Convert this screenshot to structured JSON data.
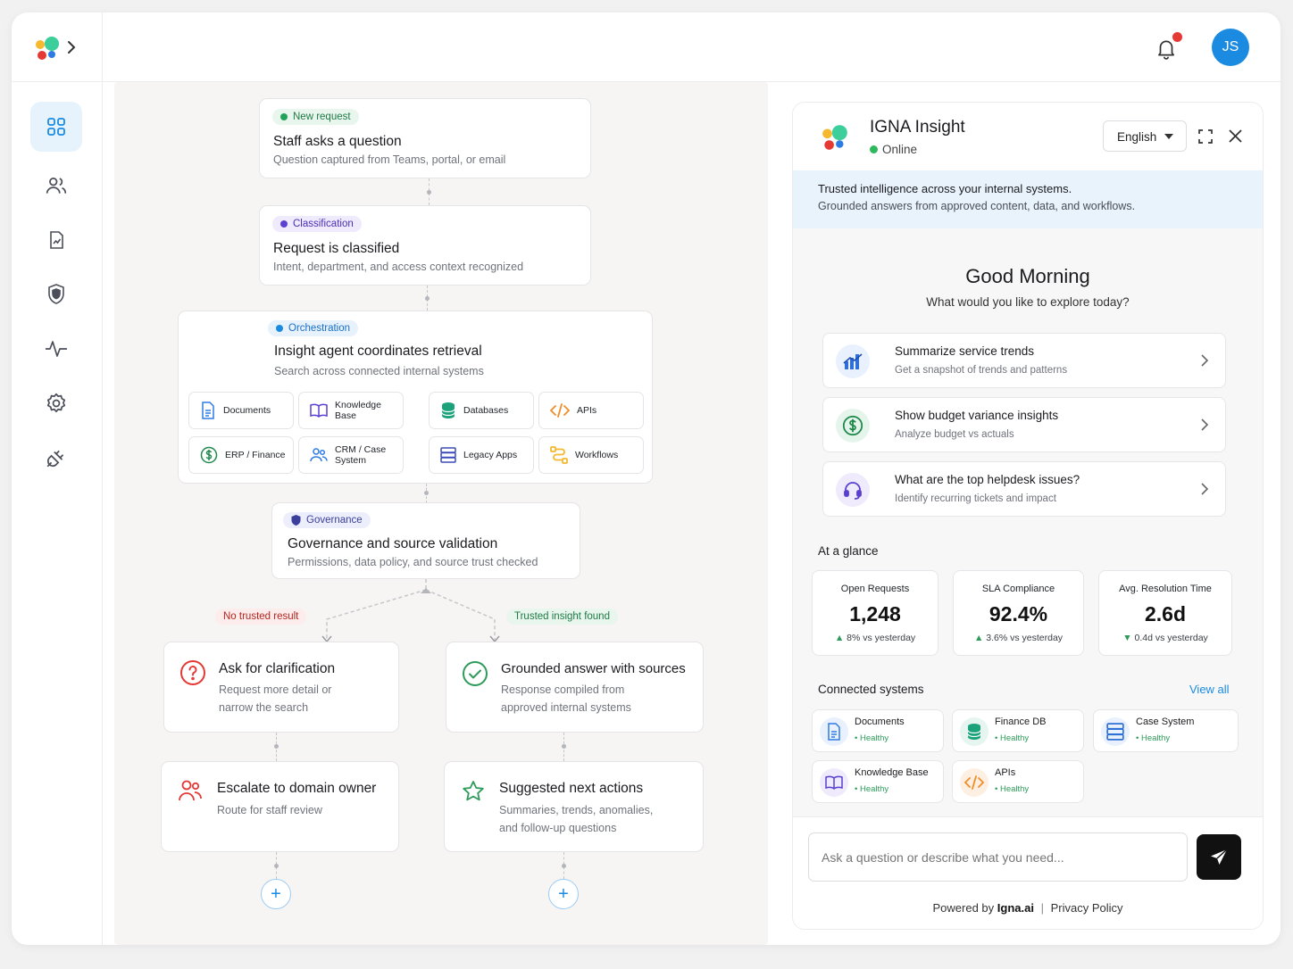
{
  "topbar": {
    "avatar_initials": "JS",
    "notification_dot": true
  },
  "sidebar": {
    "items": [
      {
        "name": "dashboard",
        "icon": "grid-icon",
        "active": true
      },
      {
        "name": "users",
        "icon": "users-icon"
      },
      {
        "name": "reports",
        "icon": "report-icon"
      },
      {
        "name": "security",
        "icon": "shield-icon"
      },
      {
        "name": "activity",
        "icon": "activity-icon"
      },
      {
        "name": "settings",
        "icon": "gear-icon"
      },
      {
        "name": "integrations",
        "icon": "plug-icon"
      }
    ]
  },
  "flow": {
    "step1": {
      "badge": "New request",
      "title": "Staff asks a question",
      "subtitle": "Question captured from Teams, portal, or email"
    },
    "step2": {
      "badge": "Classification",
      "title": "Request is classified",
      "subtitle": "Intent, department, and access context recognized"
    },
    "step3": {
      "badge": "Orchestration",
      "title": "Insight agent coordinates retrieval",
      "subtitle": "Search across connected internal systems",
      "sources": [
        "Documents",
        "Knowledge Base",
        "Databases",
        "APIs",
        "ERP / Finance",
        "CRM / Case System",
        "Legacy Apps",
        "Workflows"
      ]
    },
    "step4": {
      "badge": "Governance",
      "title": "Governance and source validation",
      "subtitle": "Permissions, data policy, and source trust checked"
    },
    "branch_fail_label": "No trusted result",
    "branch_ok_label": "Trusted insight found",
    "clarify": {
      "title": "Ask for clarification",
      "line1": "Request more detail or",
      "line2": "narrow the search"
    },
    "escalate": {
      "title": "Escalate to domain owner",
      "subtitle": "Route for staff review"
    },
    "grounded": {
      "title": "Grounded answer with sources",
      "line1": "Response compiled from",
      "line2": "approved internal systems"
    },
    "actions": {
      "title": "Suggested next actions",
      "line1": "Summaries, trends, anomalies,",
      "line2": "and follow-up questions"
    },
    "add_symbol": "+"
  },
  "panel": {
    "title": "IGNA Insight",
    "status": "Online",
    "language": "English",
    "banner_title": "Trusted intelligence across your internal systems.",
    "banner_sub": "Grounded answers from approved content, data, and workflows.",
    "greeting": "Good Morning",
    "prompt": "What would you like to explore today?",
    "suggestions": [
      {
        "title": "Summarize service trends",
        "sub": "Get a snapshot of trends and patterns",
        "icon": "bar-chart-icon"
      },
      {
        "title": "Show budget variance insights",
        "sub": "Analyze budget vs actuals",
        "icon": "dollar-icon"
      },
      {
        "title": "What are the top helpdesk issues?",
        "sub": "Identify recurring tickets and impact",
        "icon": "headset-icon"
      }
    ],
    "glance_title": "At a glance",
    "stats": [
      {
        "label": "Open Requests",
        "value": "1,248",
        "delta": "8% vs yesterday",
        "dir": "up"
      },
      {
        "label": "SLA Compliance",
        "value": "92.4%",
        "delta": "3.6% vs yesterday",
        "dir": "up"
      },
      {
        "label": "Avg. Resolution Time",
        "value": "2.6d",
        "delta": "0.4d vs yesterday",
        "dir": "down"
      }
    ],
    "systems_title": "Connected systems",
    "view_all": "View all",
    "systems": [
      {
        "name": "Documents",
        "status": "• Healthy"
      },
      {
        "name": "Finance DB",
        "status": "• Healthy"
      },
      {
        "name": "Case System",
        "status": "• Healthy"
      },
      {
        "name": "Knowledge Base",
        "status": "• Healthy"
      },
      {
        "name": "APIs",
        "status": "• Healthy"
      }
    ],
    "input_placeholder": "Ask a question or describe what you need...",
    "powered_prefix": "Powered by",
    "powered_brand": "Igna.ai",
    "separator": "|",
    "privacy": "Privacy Policy"
  },
  "colors": {
    "accent": "#1a8be0",
    "green": "#2e9b5b",
    "red": "#e53935",
    "orange": "#f28c28",
    "purple": "#5b3fd1"
  }
}
